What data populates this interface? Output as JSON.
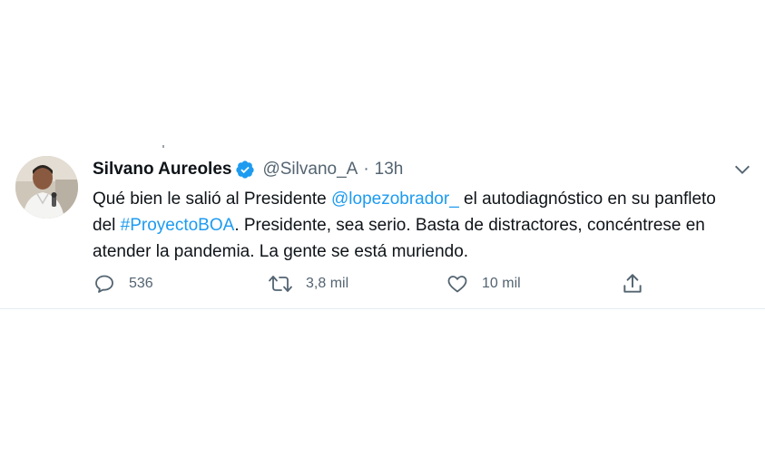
{
  "tweet": {
    "author_name": "Silvano Aureoles",
    "handle": "@Silvano_A",
    "separator": "·",
    "time": "13h",
    "text": {
      "part1": "Qué bien le salió al Presidente ",
      "mention": "@lopezobrador_",
      "part2": " el autodiagnóstico en su panfleto del ",
      "hashtag": "#ProyectoBOA",
      "part3": ". Presidente, sea serio. Basta de distractores, concéntrese en atender la pandemia. La gente se está muriendo."
    },
    "actions": {
      "replies": "536",
      "retweets": "3,8 mil",
      "likes": "10 mil"
    },
    "colors": {
      "link": "#1d9bf0",
      "muted": "#536471",
      "verified_badge": "#1d9bf0"
    },
    "icons": {
      "reply": "reply-icon",
      "retweet": "retweet-icon",
      "like": "heart-icon",
      "share": "share-icon",
      "more": "chevron-down-icon",
      "verified": "verified-badge-icon"
    }
  }
}
